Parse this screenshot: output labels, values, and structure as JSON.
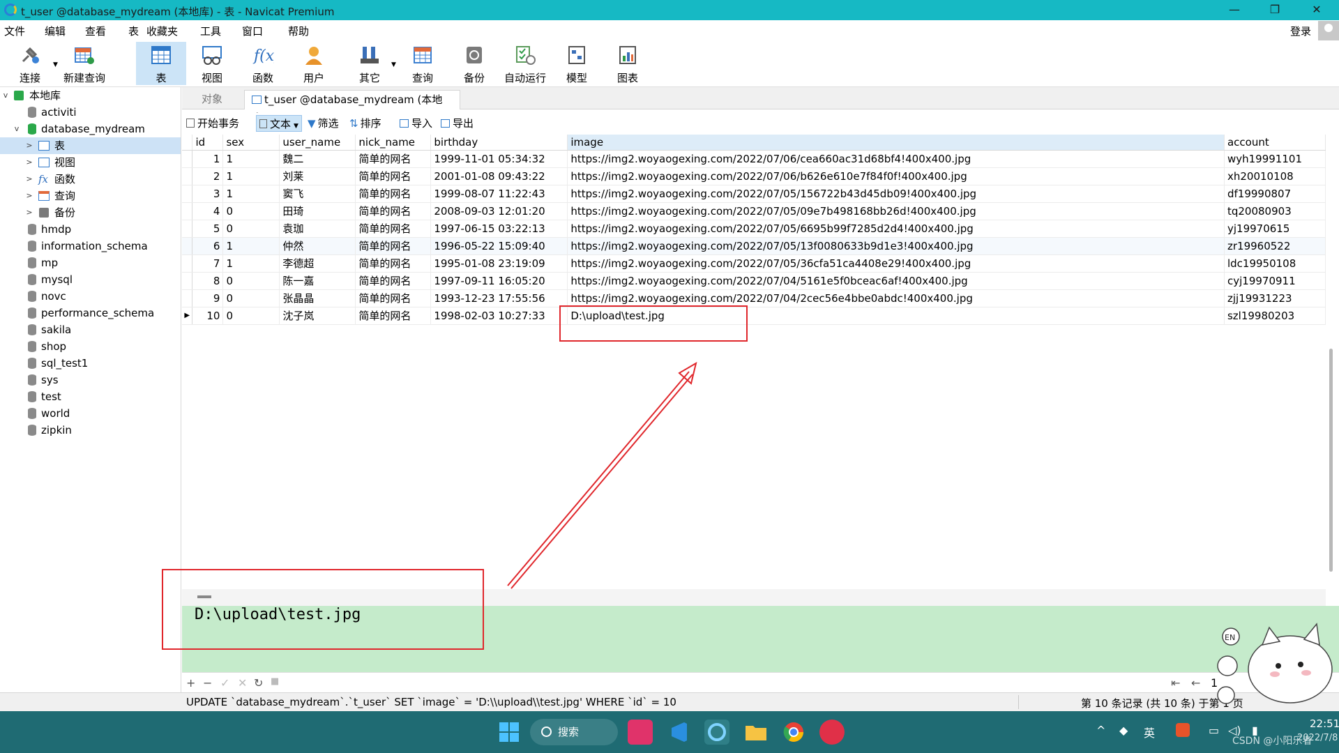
{
  "window": {
    "title": "t_user @database_mydream (本地库) - 表 - Navicat Premium",
    "min": "—",
    "max": "❐",
    "close": "✕"
  },
  "menu": [
    "文件",
    "编辑",
    "查看",
    "表",
    "收藏夹",
    "工具",
    "窗口",
    "帮助"
  ],
  "login": "登录",
  "toolbar": [
    "连接",
    "新建查询",
    "表",
    "视图",
    "函数",
    "用户",
    "其它",
    "查询",
    "备份",
    "自动运行",
    "模型",
    "图表"
  ],
  "tree": {
    "root": "本地库",
    "items": [
      "activiti",
      "database_mydream",
      "表",
      "视图",
      "函数",
      "查询",
      "备份",
      "hmdp",
      "information_schema",
      "mp",
      "mysql",
      "novc",
      "performance_schema",
      "sakila",
      "shop",
      "sql_test1",
      "sys",
      "test",
      "world",
      "zipkin"
    ]
  },
  "tabs": {
    "objects": "对象",
    "current": "t_user @database_mydream (本地库)..."
  },
  "subtool": [
    "开始事务",
    "文本",
    "筛选",
    "排序",
    "导入",
    "导出"
  ],
  "columns": [
    "id",
    "sex",
    "user_name",
    "nick_name",
    "birthday",
    "image",
    "account"
  ],
  "rows": [
    [
      "1",
      "1",
      "魏二",
      "简单的网名",
      "1999-11-01 05:34:32",
      "https://img2.woyaogexing.com/2022/07/06/cea660ac31d68bf4!400x400.jpg",
      "wyh19991101"
    ],
    [
      "2",
      "1",
      "刘莱",
      "简单的网名",
      "2001-01-08 09:43:22",
      "https://img2.woyaogexing.com/2022/07/06/b626e610e7f84f0f!400x400.jpg",
      "xh20010108"
    ],
    [
      "3",
      "1",
      "窦飞",
      "简单的网名",
      "1999-08-07 11:22:43",
      "https://img2.woyaogexing.com/2022/07/05/156722b43d45db09!400x400.jpg",
      "df19990807"
    ],
    [
      "4",
      "0",
      "田琦",
      "简单的网名",
      "2008-09-03 12:01:20",
      "https://img2.woyaogexing.com/2022/07/05/09e7b498168bb26d!400x400.jpg",
      "tq20080903"
    ],
    [
      "5",
      "0",
      "袁珈",
      "简单的网名",
      "1997-06-15 03:22:13",
      "https://img2.woyaogexing.com/2022/07/05/6695b99f7285d2d4!400x400.jpg",
      "yj19970615"
    ],
    [
      "6",
      "1",
      "仲然",
      "简单的网名",
      "1996-05-22 15:09:40",
      "https://img2.woyaogexing.com/2022/07/05/13f0080633b9d1e3!400x400.jpg",
      "zr19960522"
    ],
    [
      "7",
      "1",
      "李德超",
      "简单的网名",
      "1995-01-08 23:19:09",
      "https://img2.woyaogexing.com/2022/07/05/36cfa51ca4408e29!400x400.jpg",
      "ldc19950108"
    ],
    [
      "8",
      "0",
      "陈一嘉",
      "简单的网名",
      "1997-09-11 16:05:20",
      "https://img2.woyaogexing.com/2022/07/04/5161e5f0bceac6af!400x400.jpg",
      "cyj19970911"
    ],
    [
      "9",
      "0",
      "张晶晶",
      "简单的网名",
      "1993-12-23 17:55:56",
      "https://img2.woyaogexing.com/2022/07/04/2cec56e4bbe0abdc!400x400.jpg",
      "zjj19931223"
    ],
    [
      "10",
      "0",
      "沈子岚",
      "简单的网名",
      "1998-02-03 10:27:33",
      "D:\\upload\\test.jpg",
      "szl19980203"
    ]
  ],
  "editor_value": "D:\\upload\\test.jpg",
  "navbar": {
    "add": "+",
    "remove": "−",
    "apply": "✓",
    "cancel": "✕",
    "refresh": "↻",
    "stop": "■",
    "first": "⇤",
    "prev": "←",
    "page": "1"
  },
  "status": {
    "sql": "UPDATE `database_mydream`.`t_user` SET `image` = 'D:\\\\upload\\\\test.jpg' WHERE `id` = 10",
    "records": "第 10 条记录 (共 10 条) 于第 1 页"
  },
  "taskbar": {
    "search": "搜索",
    "ime": "英",
    "time": "22:51",
    "date": "2022/7/8",
    "watermark": "CSDN @小阳乐者"
  },
  "colors": {
    "titlebar": "#16b9c4",
    "selection": "#cce4f7",
    "editor": "#c5ebcb",
    "annotation": "#e0262b",
    "taskbar": "#1f6b73"
  }
}
